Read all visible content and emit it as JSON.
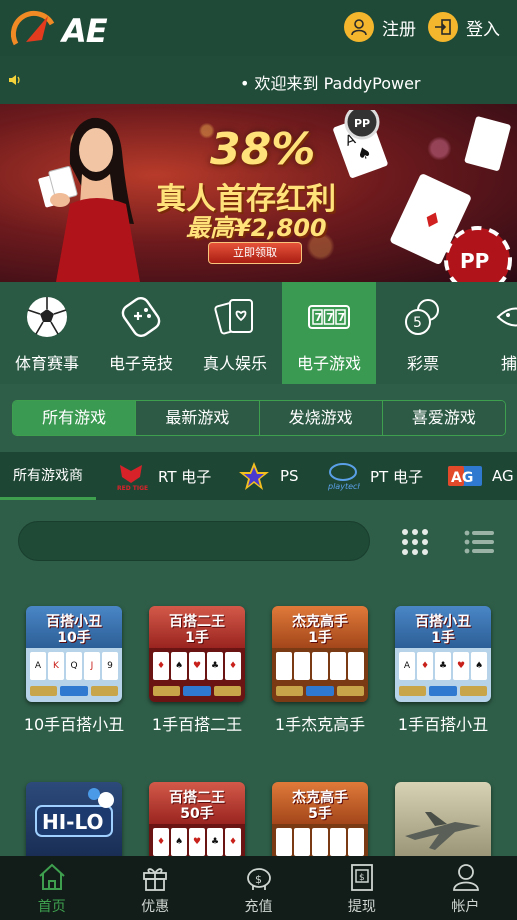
{
  "header": {
    "logo_text": "AE",
    "register_label": "注册",
    "login_label": "登入"
  },
  "marquee": {
    "text": "欢迎来到 PaddyPower"
  },
  "banner": {
    "percent": "38%",
    "title": "真人首存红利",
    "subtitle": "最高¥2,800",
    "button_label": "立即领取"
  },
  "categories": [
    {
      "label": "体育赛事",
      "icon": "soccer-ball-icon"
    },
    {
      "label": "电子竞技",
      "icon": "gamepad-icon"
    },
    {
      "label": "真人娱乐",
      "icon": "playing-cards-icon"
    },
    {
      "label": "电子游戏",
      "icon": "slot-777-icon",
      "active": true
    },
    {
      "label": "彩票",
      "icon": "lottery-balls-icon"
    },
    {
      "label": "捕鱼",
      "icon": "fish-icon"
    }
  ],
  "tabs": [
    {
      "label": "所有游戏",
      "active": true
    },
    {
      "label": "最新游戏"
    },
    {
      "label": "发烧游戏"
    },
    {
      "label": "喜爱游戏"
    }
  ],
  "providers": {
    "all_label": "所有游戏商",
    "items": [
      {
        "label": "RT 电子",
        "logo": "red-tiger-logo"
      },
      {
        "label": "PS",
        "logo": "ps-star-logo"
      },
      {
        "label": "PT 电子",
        "logo": "playtech-logo"
      },
      {
        "label": "AG",
        "logo": "ag-logo"
      }
    ]
  },
  "games": [
    {
      "thumb_title": "百搭小丑\n10手",
      "name": "10手百搭小丑",
      "theme": "blue"
    },
    {
      "thumb_title": "百搭二王\n1手",
      "name": "1手百搭二王",
      "theme": "red"
    },
    {
      "thumb_title": "杰克高手\n1手",
      "name": "1手杰克高手",
      "theme": "orange"
    },
    {
      "thumb_title": "百搭小丑\n1手",
      "name": "1手百搭小丑",
      "theme": "blue"
    },
    {
      "thumb_title": "HI-LO",
      "name": "",
      "theme": "hilo"
    },
    {
      "thumb_title": "百搭二王\n50手",
      "name": "",
      "theme": "red"
    },
    {
      "thumb_title": "杰克高手\n5手",
      "name": "",
      "theme": "orange"
    },
    {
      "thumb_title": "",
      "name": "",
      "theme": "jet"
    }
  ],
  "bottom_nav": [
    {
      "label": "首页",
      "icon": "home-icon",
      "active": true
    },
    {
      "label": "优惠",
      "icon": "gift-icon"
    },
    {
      "label": "充值",
      "icon": "piggy-bank-icon"
    },
    {
      "label": "提现",
      "icon": "atm-icon"
    },
    {
      "label": "帐户",
      "icon": "user-icon"
    }
  ],
  "colors": {
    "accent_green": "#3b9a52",
    "background": "#2e5e48",
    "gold": "#f3b62c"
  }
}
